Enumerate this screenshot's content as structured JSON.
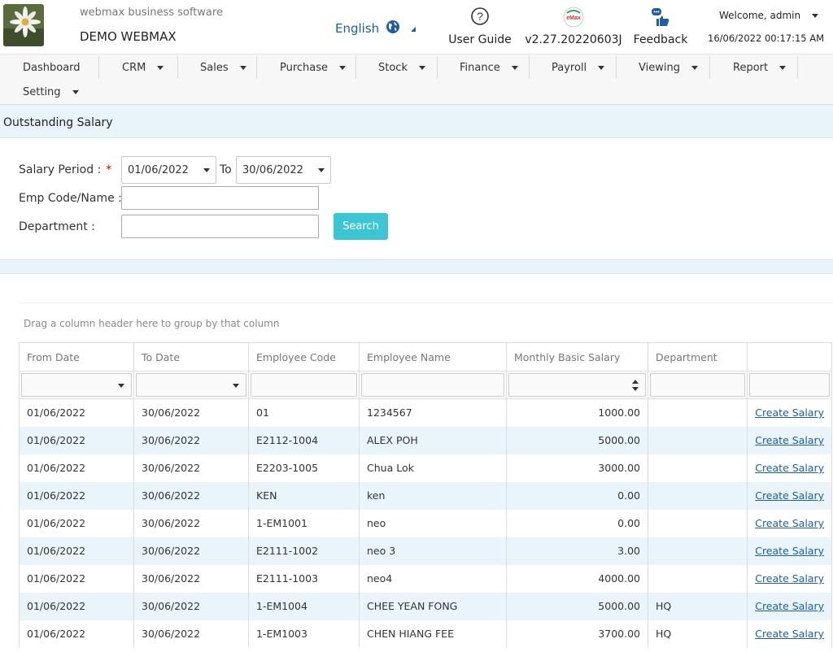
{
  "header": {
    "company_sub": "webmax business software",
    "company_name": "DEMO WEBMAX",
    "language": "English",
    "user_guide": "User Guide",
    "version": "v2.27.20220603J",
    "emax_icon_text": "eMax",
    "feedback": "Feedback",
    "welcome": "Welcome, admin",
    "datetime": "16/06/2022 00:17:15 AM"
  },
  "menu": {
    "items": [
      "Dashboard",
      "CRM",
      "Sales",
      "Purchase",
      "Stock",
      "Finance",
      "Payroll",
      "Viewing",
      "Report",
      "Setting"
    ]
  },
  "page": {
    "title": "Outstanding Salary"
  },
  "form": {
    "salary_period_label": "Salary Period :",
    "required_mark": "*",
    "from_date": "01/06/2022",
    "to_label": "To",
    "to_date": "30/06/2022",
    "emp_label": "Emp Code/Name :",
    "emp_value": "",
    "dept_label": "Department :",
    "dept_value": "",
    "search_label": "Search"
  },
  "grid": {
    "group_hint": "Drag a column header here to group by that column",
    "columns": [
      "From Date",
      "To Date",
      "Employee Code",
      "Employee Name",
      "Monthly Basic Salary",
      "Department",
      ""
    ],
    "action_label": "Create Salary",
    "rows": [
      [
        "01/06/2022",
        "30/06/2022",
        "01",
        "1234567",
        "1000.00",
        ""
      ],
      [
        "01/06/2022",
        "30/06/2022",
        "E2112-1004",
        "ALEX POH",
        "5000.00",
        ""
      ],
      [
        "01/06/2022",
        "30/06/2022",
        "E2203-1005",
        "Chua Lok",
        "3000.00",
        ""
      ],
      [
        "01/06/2022",
        "30/06/2022",
        "KEN",
        "ken",
        "0.00",
        ""
      ],
      [
        "01/06/2022",
        "30/06/2022",
        "1-EM1001",
        "neo",
        "0.00",
        ""
      ],
      [
        "01/06/2022",
        "30/06/2022",
        "E2111-1002",
        "neo 3",
        "3.00",
        ""
      ],
      [
        "01/06/2022",
        "30/06/2022",
        "E2111-1003",
        "neo4",
        "4000.00",
        ""
      ],
      [
        "01/06/2022",
        "30/06/2022",
        "1-EM1004",
        "CHEE YEAN FONG",
        "5000.00",
        "HQ"
      ],
      [
        "01/06/2022",
        "30/06/2022",
        "1-EM1003",
        "CHEN HIANG FEE",
        "3700.00",
        "HQ"
      ]
    ]
  },
  "colors": {
    "accent": "#3cc5d3",
    "link": "#1d5fa0",
    "row_alt": "#eaf4fb",
    "background": "#e8f3fa"
  }
}
